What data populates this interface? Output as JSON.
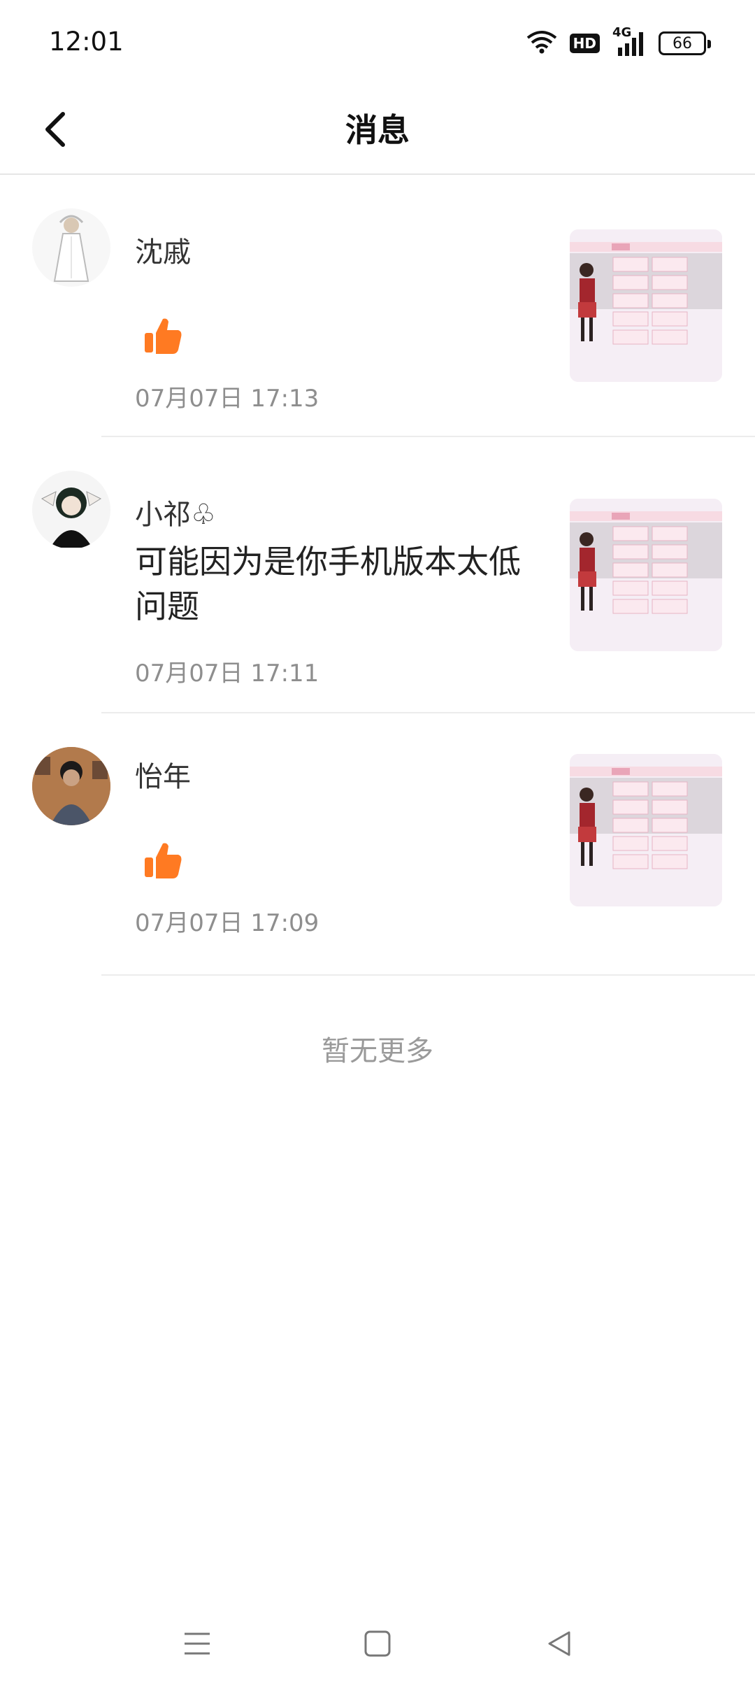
{
  "status_bar": {
    "time": "12:01",
    "network_label": "4G",
    "hd_label": "HD",
    "battery": "66"
  },
  "header": {
    "title": "消息"
  },
  "messages": [
    {
      "name": "沈戚",
      "type": "like",
      "time": "07月07日 17:13",
      "avatar_icon": "avatar-white-dress-girl"
    },
    {
      "name": "小祁♧",
      "type": "comment",
      "text": "可能因为是你手机版本太低问题",
      "time": "07月07日 17:11",
      "avatar_icon": "avatar-dark-hair-girl"
    },
    {
      "name": "怡年",
      "type": "like",
      "time": "07月07日 17:09",
      "avatar_icon": "avatar-boy-portrait"
    }
  ],
  "footer_text": "暂无更多",
  "colors": {
    "accent": "#ff7a22",
    "time_text": "#8e8e8e",
    "divider": "#ececec"
  }
}
